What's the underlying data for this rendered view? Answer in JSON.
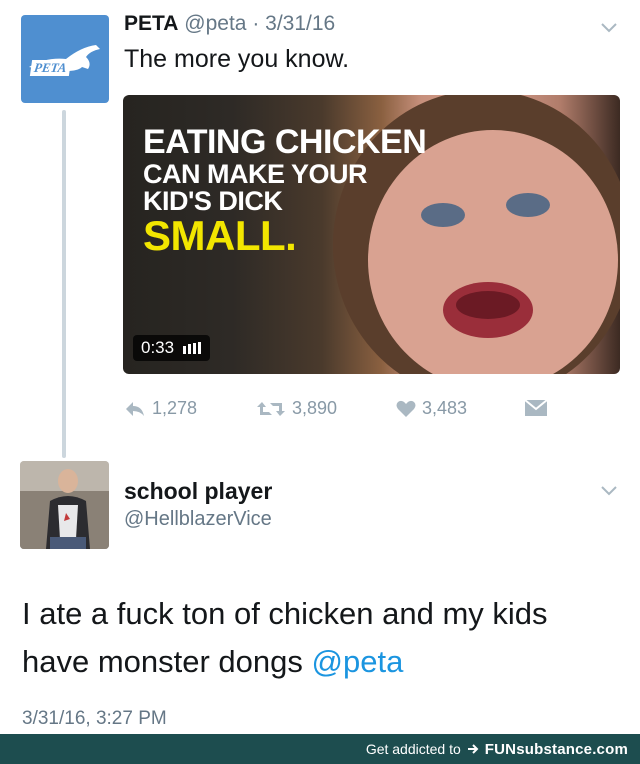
{
  "original_tweet": {
    "author_name": "PETA",
    "handle_date": "@peta · 3/31/16",
    "text": "The more you know.",
    "avatar_logo_text": "PETA",
    "media": {
      "line1": "EATING CHICKEN",
      "line2": "CAN MAKE YOUR",
      "line3": "KID'S DICK",
      "line4": "SMALL.",
      "duration": "0:33"
    },
    "stats": {
      "replies": "1,278",
      "retweets": "3,890",
      "likes": "3,483"
    },
    "icons": [
      "reply-icon",
      "retweet-icon",
      "heart-icon",
      "message-icon",
      "chevron-down-icon"
    ]
  },
  "reply_tweet": {
    "author_name": "school player",
    "handle": "@HellblazerVice",
    "text": "I ate a fuck ton of chicken and my kids have monster dongs ",
    "mention": "@peta",
    "timestamp": "3/31/16, 3:27 PM"
  },
  "footer": {
    "prefix": "Get addicted to",
    "brand": "FUNsubstance.com"
  },
  "colors": {
    "peta_blue": "#4f8fd0",
    "mention_blue": "#1b95e0",
    "footer_bg": "#1d4d4f",
    "highlight_yellow": "#f2e600"
  }
}
